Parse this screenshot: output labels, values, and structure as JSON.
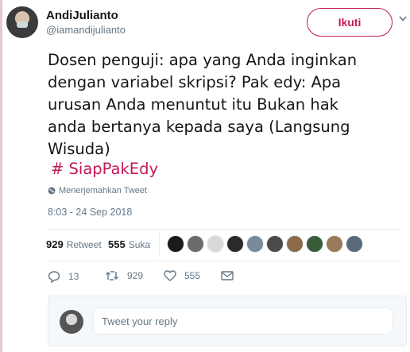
{
  "author": {
    "display_name": "AndiJulianto",
    "handle": "@iamandijulianto"
  },
  "follow_label": "Ikuti",
  "tweet": {
    "lines": [
      "Dosen penguji: apa yang Anda inginkan",
      "dengan variabel skripsi? Pak edy: Apa",
      "urusan Anda menuntut itu Bukan hak",
      "anda bertanya kepada saya (Langsung",
      "Wisuda)"
    ],
    "hashtag": "# SiapPakEdy"
  },
  "translate_label": "Menerjemahkan Tweet",
  "timestamp": "8:03 - 24 Sep 2018",
  "stats": {
    "retweets_count": "929",
    "retweets_label": "Retweet",
    "likes_count": "555",
    "likes_label": "Suka"
  },
  "actions": {
    "reply_count": "13",
    "retweet_count": "929",
    "like_count": "555"
  },
  "reply": {
    "placeholder": "Tweet your reply"
  },
  "colors": {
    "accent": "#c2195a",
    "secondary_text": "#657786",
    "border": "#e6ecf0"
  },
  "liker_colors": [
    "#1a1a1a",
    "#6b6b6b",
    "#d9d9d9",
    "#2a2a2a",
    "#7a8a9a",
    "#4a4a4a",
    "#8b6b4b",
    "#3a5a3a",
    "#9a7a5a",
    "#5a6a7a"
  ]
}
